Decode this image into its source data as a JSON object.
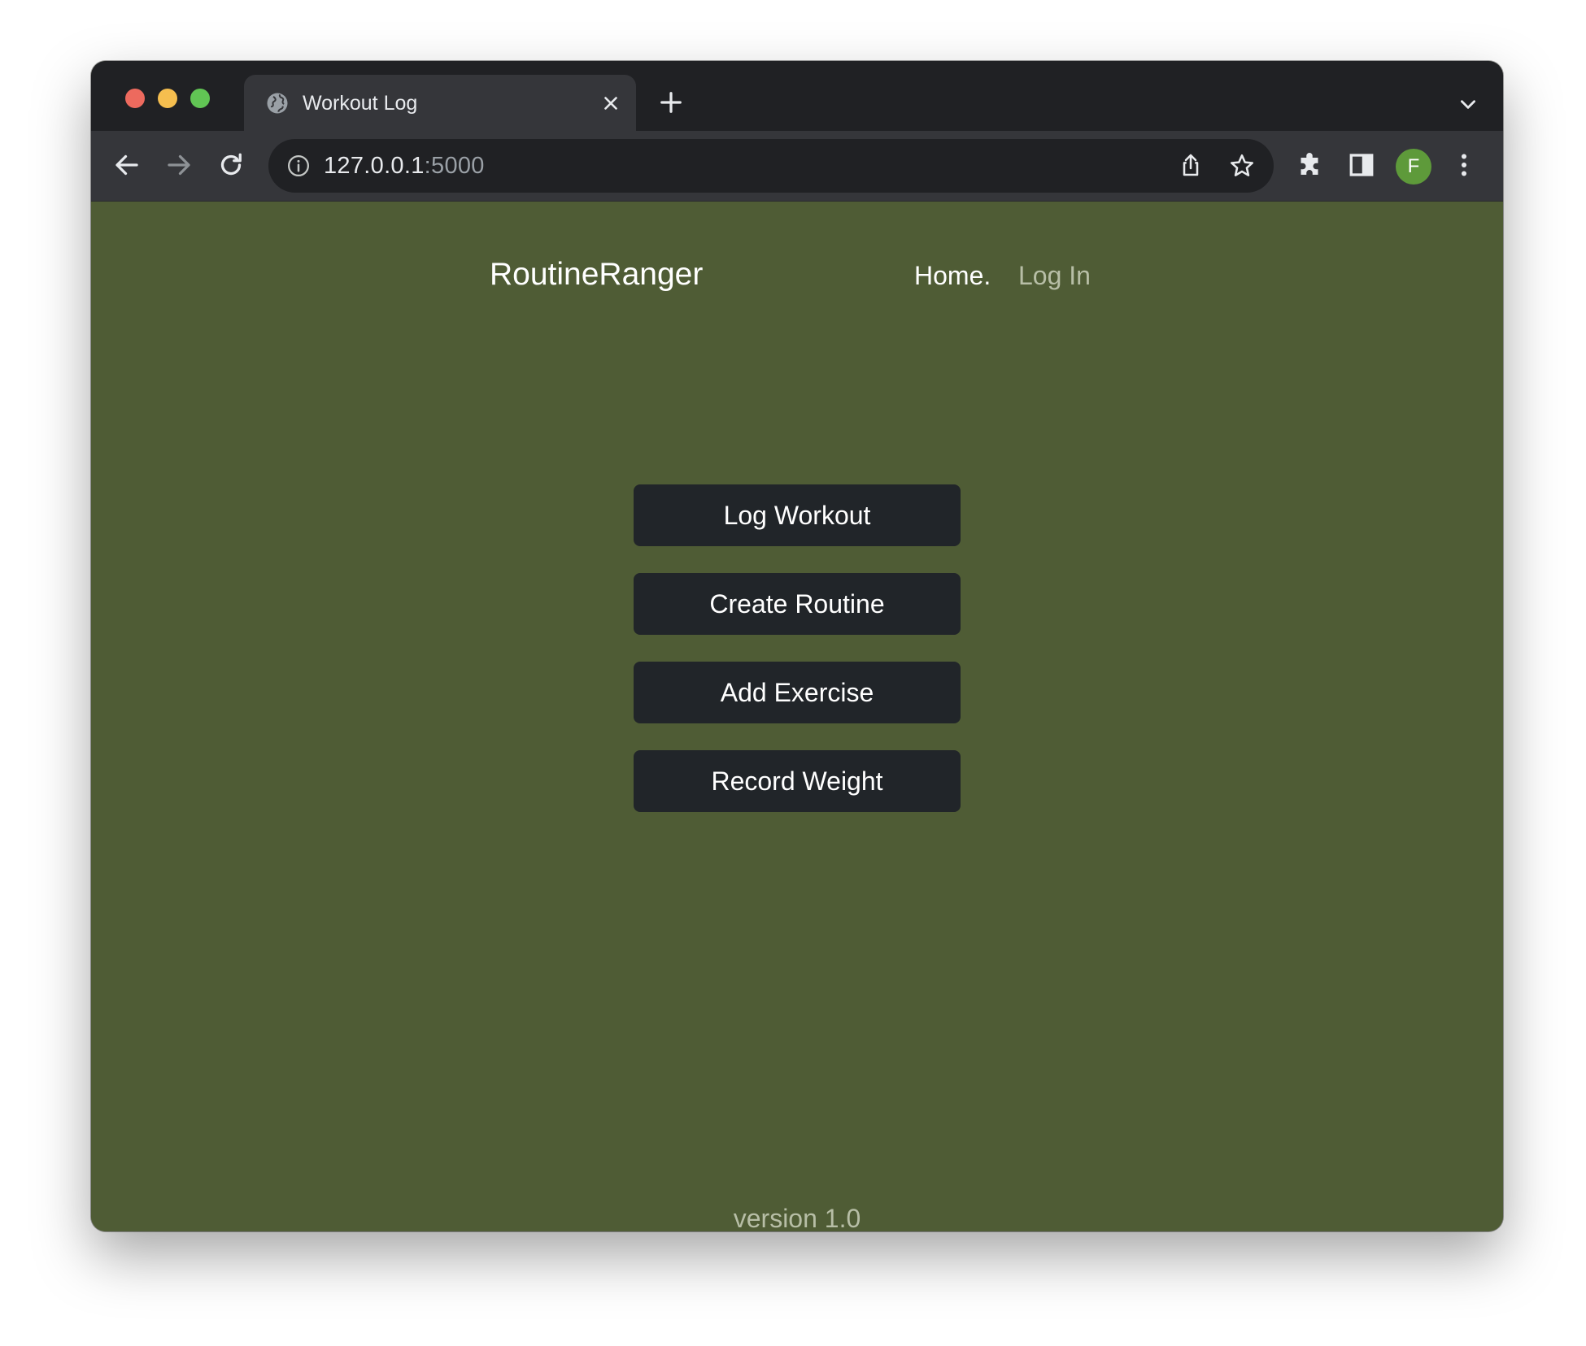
{
  "browser": {
    "tab_title": "Workout Log",
    "url_host": "127.0.0.1",
    "url_port": ":5000",
    "profile_initial": "F"
  },
  "site": {
    "brand": "RoutineRanger",
    "nav": {
      "home": "Home.",
      "login": "Log In"
    }
  },
  "actions": [
    {
      "label": "Log Workout"
    },
    {
      "label": "Create Routine"
    },
    {
      "label": "Add Exercise"
    },
    {
      "label": "Record Weight"
    }
  ],
  "footer": {
    "version": "version 1.0"
  },
  "icons": {
    "tab": "globe-icon",
    "tab_close": "close-icon",
    "new_tab": "plus-icon",
    "tab_search": "chevron-down-icon",
    "back": "arrow-left-icon",
    "forward": "arrow-right-icon",
    "reload": "reload-icon",
    "site_info": "info-icon",
    "share": "share-icon",
    "bookmark": "star-icon",
    "extensions": "puzzle-icon",
    "side_panel": "side-panel-icon",
    "menu": "more-vertical-icon"
  },
  "colors": {
    "page_background": "#4f5c35",
    "button_background": "#212529",
    "chrome_dark": "#202124",
    "chrome_toolbar": "#35363a",
    "avatar": "#5e9a3a"
  }
}
